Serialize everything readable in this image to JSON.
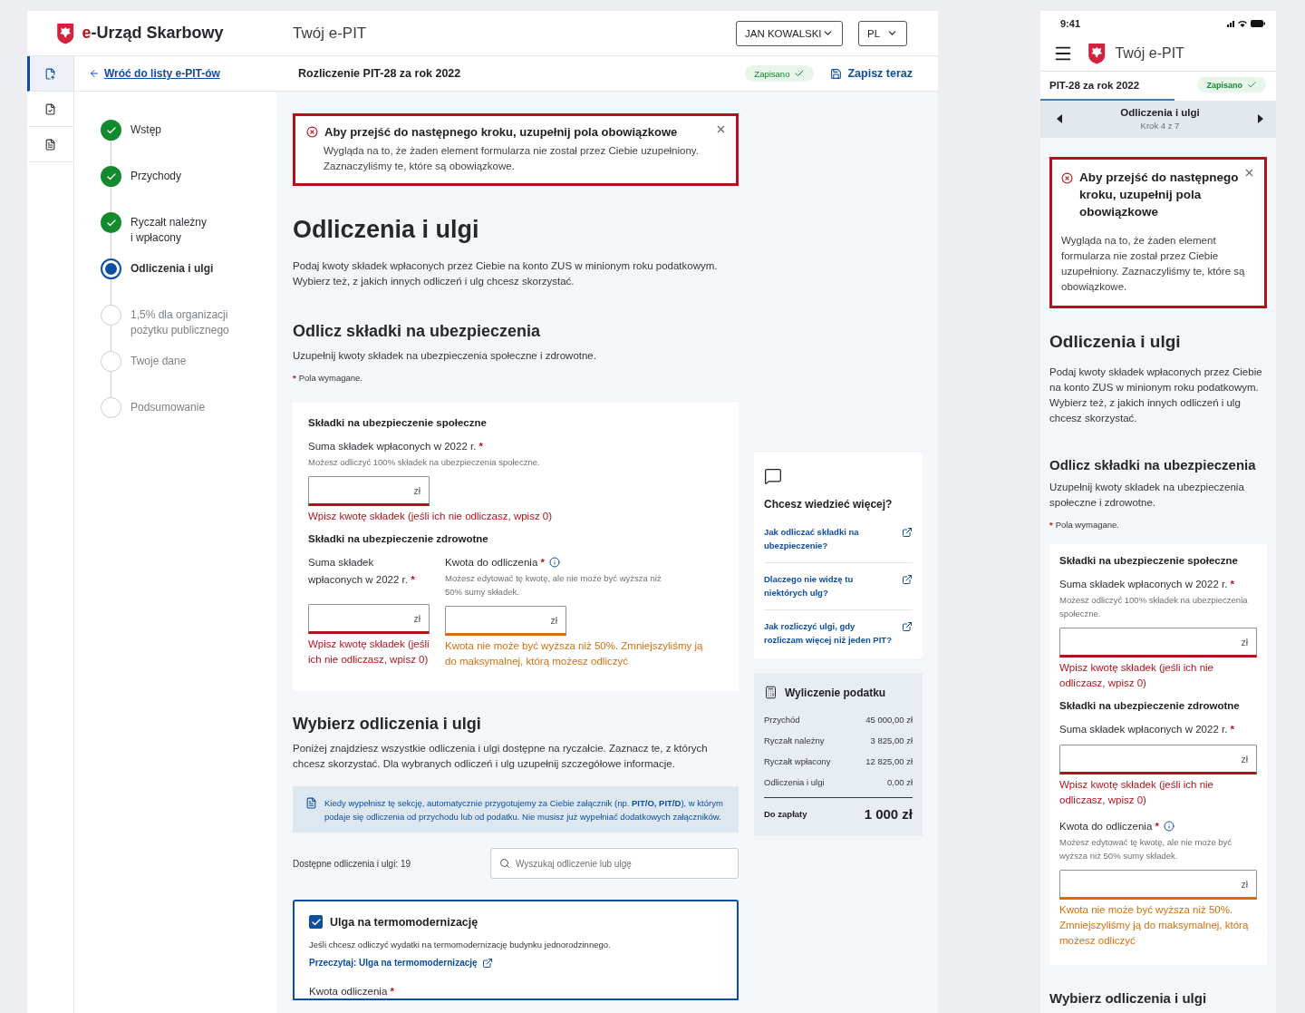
{
  "desktop": {
    "header": {
      "brand_mark": "e",
      "brand_name": "-Urząd Skarbowy",
      "app_title": "Twój e-PIT",
      "user": "JAN KOWALSKI",
      "language": "PL"
    },
    "rail": [
      {
        "kind": "add",
        "selected": true
      },
      {
        "kind": "check",
        "selected": false
      },
      {
        "kind": "list",
        "selected": false
      }
    ],
    "subheader": {
      "back": "Wróć do listy e-PIT-ów",
      "title": "Rozliczenie PIT-28 za rok 2022",
      "saved": "Zapisano",
      "save": "Zapisz teraz"
    },
    "steps": [
      {
        "label": "Wstęp",
        "done": true,
        "selected": false
      },
      {
        "label": "Przychody",
        "done": true,
        "selected": false
      },
      {
        "label": "Ryczałt należny\ni wpłacony",
        "done": true,
        "selected": false
      },
      {
        "label": "Odliczenia i ulgi",
        "done": false,
        "selected": true
      },
      {
        "label": "1,5% dla organizacji\npożytku publicznego",
        "done": false,
        "selected": false
      },
      {
        "label": "Twoje dane",
        "done": false,
        "selected": false
      },
      {
        "label": "Podsumowanie",
        "done": false,
        "selected": false
      }
    ],
    "alert": {
      "title": "Aby przejść do następnego kroku, uzupełnij pola obowiązkowe",
      "body": "Wygląda na to, że żaden element formularza nie został przez Ciebie uzupełniony. Zaznaczyliśmy te, które są obowiązkowe."
    },
    "title": "Odliczenia i ulgi",
    "intro": "Podaj kwoty składek wpłaconych przez Ciebie na konto ZUS w minionym roku podatkowym. Wybierz też, z jakich innych odliczeń i ulg chcesz skorzystać.",
    "insurance": {
      "title": "Odlicz składki na ubezpieczenia",
      "intro": "Uzupełnij kwoty składek na ubezpieczenia społeczne i zdrowotne.",
      "required_mark": "*",
      "required_note": "Pola wymagane.",
      "social": {
        "heading": "Składki na ubezpieczenie społeczne",
        "fields": [
          {
            "label": "Suma składek wpłaconych w 2022 r.",
            "required_mark": "*",
            "hint": "Możesz odliczyć 100% składek na ubezpieczenia społeczne.",
            "unit": "zł",
            "kind": "error",
            "message": "Wpisz kwotę składek (jeśli ich nie odliczasz, wpisz 0)"
          }
        ]
      },
      "health": {
        "heading": "Składki na ubezpieczenie zdrowotne",
        "fields": [
          {
            "label": "Suma składek wpłaconych w 2022 r.",
            "required_mark": "*",
            "unit": "zł",
            "kind": "error",
            "message": "Wpisz kwotę składek (jeśli ich nie odliczasz, wpisz 0)"
          },
          {
            "label": "Kwota do odliczenia",
            "required_mark": "*",
            "has_info": true,
            "hint": "Możesz edytować tę kwotę, ale nie może być wyższa niż 50% sumy składek.",
            "unit": "zł",
            "kind": "warning",
            "message": "Kwota nie może być wyższa niż 50%. Zmniejszyliśmy ją do maksymalnej, którą możesz odliczyć"
          }
        ]
      }
    },
    "choose": {
      "title": "Wybierz odliczenia i ulgi",
      "intro": "Poniżej znajdziesz wszystkie odliczenia i ulgi dostępne na ryczałcie. Zaznacz te, z których chcesz skorzystać. Dla wybranych odliczeń i ulg uzupełnij szczegółowe informacje.",
      "info": "Kiedy wypełnisz tę sekcję, automatycznie przygotujemy za Ciebie załącznik (np. **PIT/O, PIT/D**), w którym podaje się odliczenia od przychodu lub od podatku. Nie musisz już wypełniać dodatkowych załączników.",
      "available": "Dostępne odliczenia i ulgi: 19",
      "search_placeholder": "Wyszukaj odliczenie lub ulgę",
      "items": [
        {
          "title": "Ulga na termomodernizację",
          "checked": true,
          "description": "Jeśli chcesz odliczyć wydatki na termomodernizację budynku jednorodzinnego.",
          "link": "Przeczytaj: Ulga na termomodernizację",
          "field_label": "Kwota odliczenia",
          "required_mark": "*"
        }
      ]
    },
    "help": {
      "title": "Chcesz wiedzieć więcej?",
      "links": [
        "Jak odliczać składki na ubezpieczenie?",
        "Dlaczego nie widzę tu niektórych ulg?",
        "Jak rozliczyć ulgi, gdy rozliczam więcej niż jeden PIT?"
      ]
    },
    "tax": {
      "title": "Wyliczenie podatku",
      "rows": [
        {
          "label": "Przychód",
          "value": "45 000,00 zł"
        },
        {
          "label": "Ryczałt należny",
          "value": "3 825,00 zł"
        },
        {
          "label": "Ryczałt wpłacony",
          "value": "12 825,00 zł"
        },
        {
          "label": "Odliczenia i ulgi",
          "value": "0,00 zł"
        }
      ],
      "total": {
        "label": "Do zapłaty",
        "value": "1 000 zł"
      }
    }
  },
  "mobile": {
    "time": "9:41",
    "app_title": "Twój e-PIT",
    "doc_title": "PIT-28 za rok 2022",
    "saved": "Zapisano",
    "progress": {
      "level": 0.57
    },
    "step": {
      "title": "Odliczenia i ulgi",
      "counter": "Krok 4 z 7"
    },
    "alert": {
      "title": "Aby przejść do następnego kroku, uzupełnij pola obowiązkowe",
      "body": "Wygląda na to, że żaden element formularza nie został przez Ciebie uzupełniony. Zaznaczyliśmy te, które są obowiązkowe."
    },
    "title": "Odliczenia i ulgi",
    "intro": "Podaj kwoty składek wpłaconych przez Ciebie na konto ZUS w minionym roku podatkowym. Wybierz też, z jakich innych odliczeń i ulg chcesz skorzystać.",
    "insurance": {
      "title": "Odlicz składki na ubezpieczenia",
      "intro": "Uzupełnij kwoty składek na ubezpieczenia społeczne i zdrowotne.",
      "required_mark": "*",
      "required_note": "Pola wymagane.",
      "social": {
        "heading": "Składki na ubezpieczenie społeczne",
        "fields": [
          {
            "label": "Suma składek wpłaconych w 2022 r.",
            "required_mark": "*",
            "hint": "Możesz odliczyć 100% składek na ubezpieczenia społeczne.",
            "unit": "zł",
            "kind": "error",
            "message": "Wpisz kwotę składek (jeśli ich nie odliczasz, wpisz 0)"
          }
        ]
      },
      "health": {
        "heading": "Składki na ubezpieczenie zdrowotne",
        "fields": [
          {
            "label": "Suma składek wpłaconych w 2022 r.",
            "required_mark": "*",
            "unit": "zł",
            "kind": "error",
            "message": "Wpisz kwotę składek (jeśli ich nie odliczasz, wpisz 0)"
          },
          {
            "label": "Kwota do odliczenia",
            "required_mark": "*",
            "has_info": true,
            "hint": "Możesz edytować tę kwotę, ale nie może być wyższa niż 50% sumy składek.",
            "unit": "zł",
            "kind": "warning",
            "message": "Kwota nie może być wyższa niż 50%. Zmniejszyliśmy ją do maksymalnej, którą możesz odliczyć"
          }
        ]
      }
    },
    "next_title": "Wybierz odliczenia i ulgi"
  }
}
